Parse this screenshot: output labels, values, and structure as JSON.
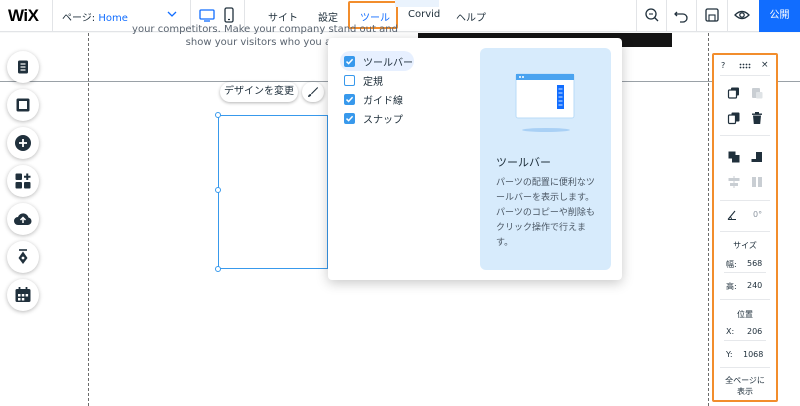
{
  "topbar": {
    "logo": "WiX",
    "page_label": "ページ:",
    "page_value": "Home",
    "menu": [
      "サイト",
      "設定",
      "ツール",
      "Corvid",
      "ヘルプ"
    ],
    "publish": "公開"
  },
  "canvas": {
    "site_text_line1": "your competitors. Make your company stand out and",
    "site_text_line2": "show your visitors who you are."
  },
  "left_toolbar": [
    {
      "icon": "pages-icon"
    },
    {
      "icon": "background-icon"
    },
    {
      "icon": "add-icon"
    },
    {
      "icon": "app-market-icon"
    },
    {
      "icon": "upload-icon"
    },
    {
      "icon": "blog-icon"
    },
    {
      "icon": "bookings-icon"
    }
  ],
  "selection": {
    "design_button": "デザインを変更"
  },
  "tools_dropdown": {
    "items": [
      {
        "label": "ツールバー",
        "checked": true
      },
      {
        "label": "定規",
        "checked": false
      },
      {
        "label": "ガイド線",
        "checked": true
      },
      {
        "label": "スナップ",
        "checked": true
      }
    ],
    "info_title": "ツールバー",
    "info_text": "パーツの配置に便利なツールバーを表示します。パーツのコピーや削除もクリック操作で行えます。"
  },
  "right_panel": {
    "help": "?",
    "close": "×",
    "rotation": "0°",
    "size_label": "サイズ",
    "width_key": "幅:",
    "width_value": "568",
    "height_key": "高:",
    "height_value": "240",
    "position_label": "位置",
    "x_key": "X:",
    "x_value": "206",
    "y_key": "Y:",
    "y_value": "1068",
    "footer_line1": "全ページに",
    "footer_line2": "表示"
  },
  "colors": {
    "accent": "#116dff",
    "highlight_border": "#f28d2c",
    "checkbox": "#3899ec",
    "info_bg": "#d7ebfc"
  }
}
